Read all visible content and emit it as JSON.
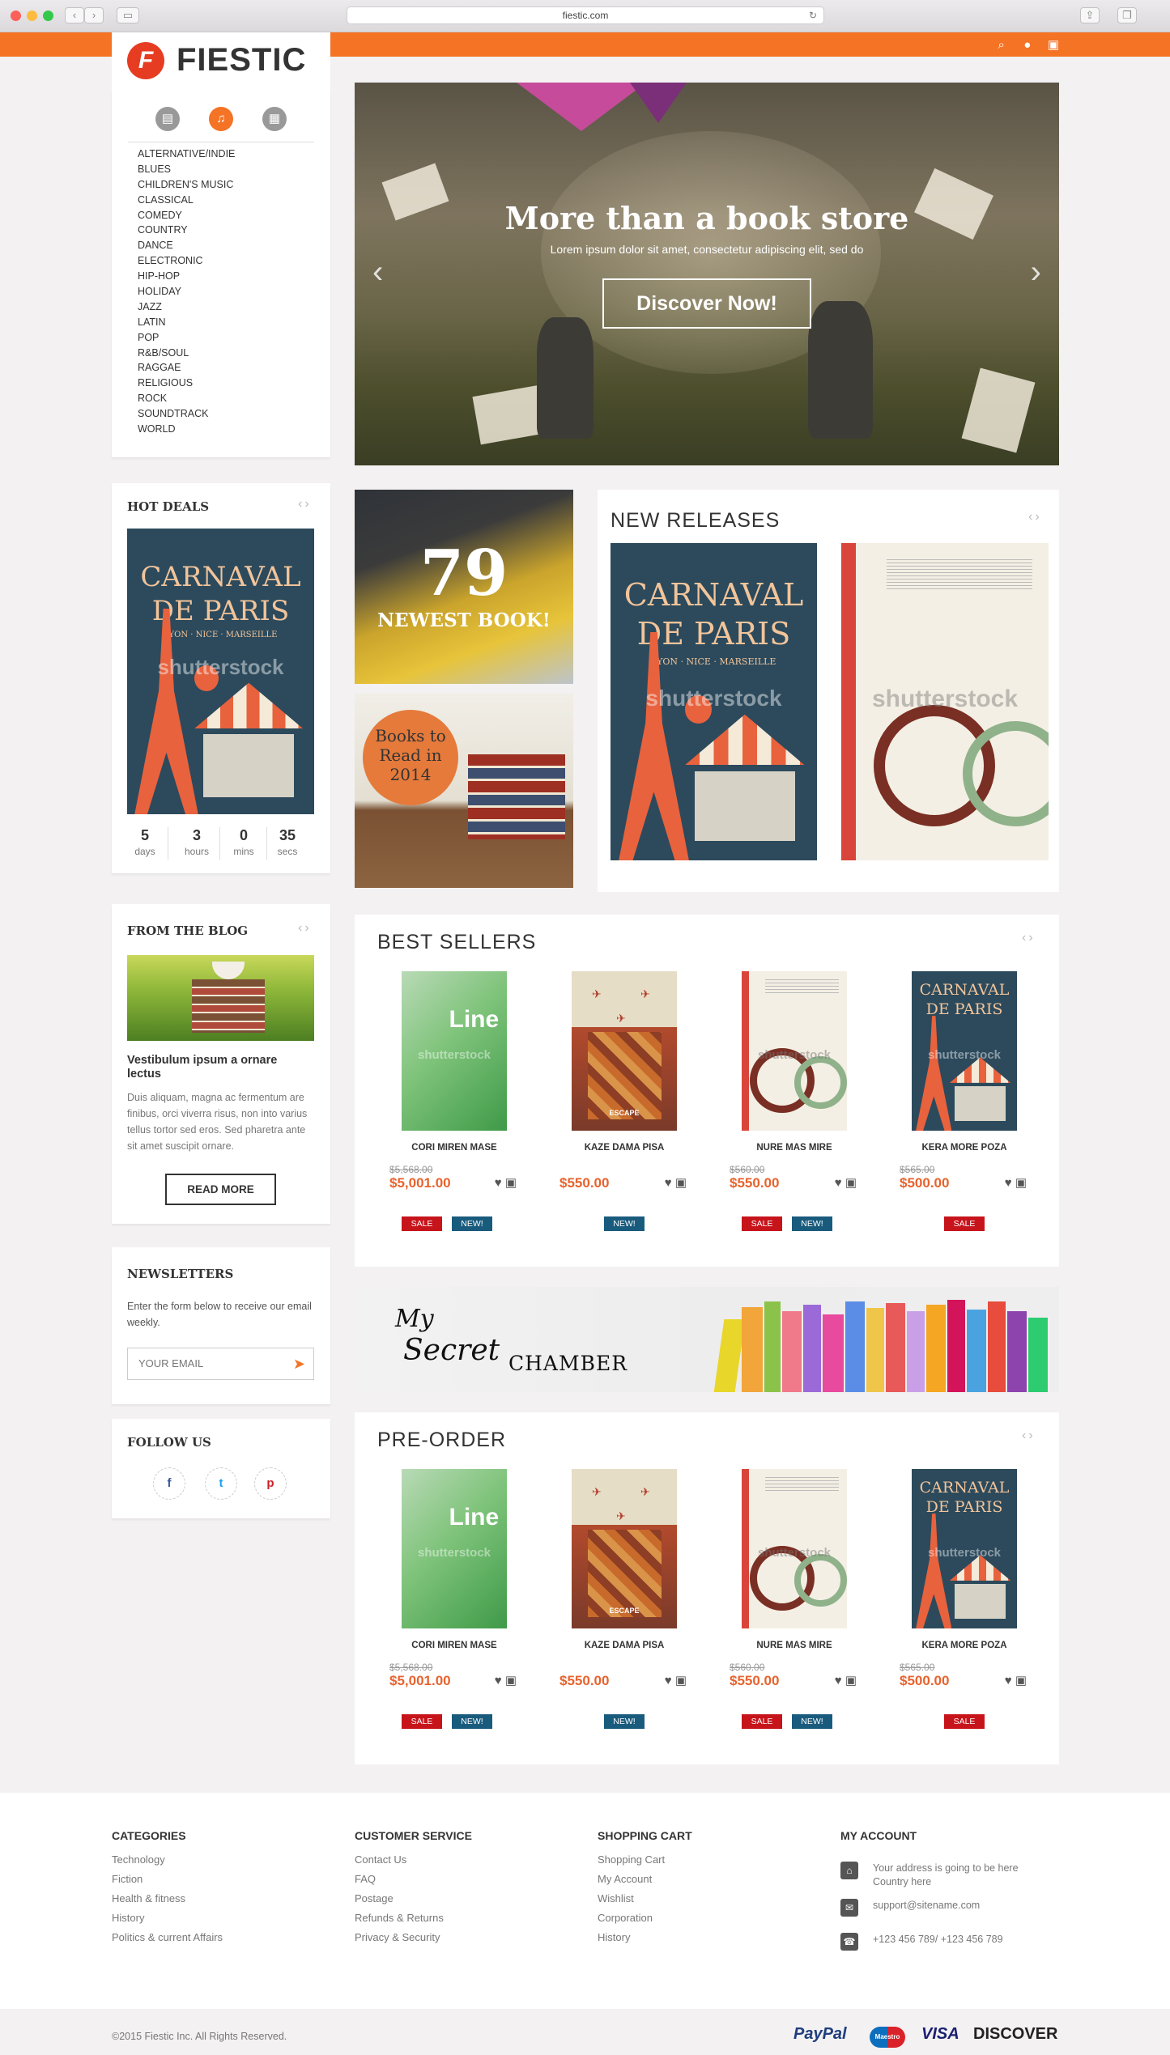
{
  "browser": {
    "url": "fiestic.com"
  },
  "brand": {
    "name": "FIESTIC",
    "letter": "F",
    "accent": "#f47325"
  },
  "header_icons": [
    "search-icon",
    "user-icon",
    "shopping-bag-icon"
  ],
  "categories": [
    "ALTERNATIVE/INDIE",
    "BLUES",
    "CHILDREN'S MUSIC",
    "CLASSICAL",
    "COMEDY",
    "COUNTRY",
    "DANCE",
    "ELECTRONIC",
    "HIP-HOP",
    "HOLIDAY",
    "JAZZ",
    "LATIN",
    "POP",
    "R&B/SOUL",
    "RAGGAE",
    "RELIGIOUS",
    "ROCK",
    "SOUNDTRACK",
    "WORLD"
  ],
  "hot_deals": {
    "title": "HOT DEALS",
    "cover": {
      "line1": "CARNAVAL",
      "line2": "DE PARIS",
      "line3": "LYON · NICE · MARSEILLE"
    },
    "countdown": [
      {
        "num": "5",
        "unit": "days"
      },
      {
        "num": "3",
        "unit": "hours"
      },
      {
        "num": "0",
        "unit": "mins"
      },
      {
        "num": "35",
        "unit": "secs"
      }
    ]
  },
  "blog": {
    "title": "FROM THE BLOG",
    "post_title": "Vestibulum ipsum a ornare lectus",
    "excerpt": "Duis aliquam, magna ac fermentum are finibus, orci viverra risus, non into varius tellus tortor sed eros. Sed pharetra ante sit amet suscipit ornare.",
    "button": "READ MORE"
  },
  "newsletter": {
    "title": "NEWSLETTERS",
    "text": "Enter the form below to receive our email weekly.",
    "placeholder": "YOUR EMAIL"
  },
  "follow": {
    "title": "FOLLOW US",
    "icons": [
      "facebook-icon",
      "twitter-icon",
      "pinterest-icon"
    ],
    "labels": [
      "f",
      "t",
      "p"
    ]
  },
  "hero": {
    "title": "More than a book store",
    "subtitle": "Lorem ipsum dolor sit amet, consectetur adipiscing elit, sed do",
    "cta": "Discover Now!"
  },
  "promo": {
    "number": "79",
    "number_text": "NEWEST BOOK!",
    "badge": "Books to Read in 2014"
  },
  "watermark": "shutterstock",
  "new_releases": {
    "title": "NEW RELEASES"
  },
  "best_sellers": {
    "title": "BEST SELLERS",
    "products": [
      {
        "name": "CORI MIREN MASE",
        "old": "$5,568.00",
        "price": "$5,001.00",
        "tags": [
          "SALE",
          "NEW!"
        ],
        "cover": "line"
      },
      {
        "name": "KAZE DAMA PISA",
        "old": "",
        "price": "$550.00",
        "tags": [
          "NEW!"
        ],
        "cover": "escape"
      },
      {
        "name": "NURE MAS MIRE",
        "old": "$560.00",
        "price": "$550.00",
        "tags": [
          "SALE",
          "NEW!"
        ],
        "cover": "bo"
      },
      {
        "name": "KERA MORE POZA",
        "old": "$565.00",
        "price": "$500.00",
        "tags": [
          "SALE"
        ],
        "cover": "carnaval"
      }
    ]
  },
  "banner": {
    "line1": "My",
    "line2": "Secret",
    "line3": "CHAMBER"
  },
  "pre_order": {
    "title": "PRE-ORDER",
    "products": [
      {
        "name": "CORI MIREN MASE",
        "old": "$5,568.00",
        "price": "$5,001.00",
        "tags": [
          "SALE",
          "NEW!"
        ],
        "cover": "line"
      },
      {
        "name": "KAZE DAMA PISA",
        "old": "",
        "price": "$550.00",
        "tags": [
          "NEW!"
        ],
        "cover": "escape"
      },
      {
        "name": "NURE MAS MIRE",
        "old": "$560.00",
        "price": "$550.00",
        "tags": [
          "SALE",
          "NEW!"
        ],
        "cover": "bo"
      },
      {
        "name": "KERA MORE POZA",
        "old": "$565.00",
        "price": "$500.00",
        "tags": [
          "SALE"
        ],
        "cover": "carnaval"
      }
    ]
  },
  "line_cover_text": "Line",
  "escape_cover_text": "ESCAPE",
  "footer": {
    "categories": {
      "title": "CATEGORIES",
      "links": [
        "Technology",
        "Fiction",
        "Health & fitness",
        "History",
        "Politics & current Affairs"
      ]
    },
    "customer_service": {
      "title": "CUSTOMER SERVICE",
      "links": [
        "Contact Us",
        "FAQ",
        "Postage",
        "Refunds & Returns",
        "Privacy & Security"
      ]
    },
    "shopping_cart": {
      "title": "SHOPPING CART",
      "links": [
        "Shopping Cart",
        "My Account",
        "Wishlist",
        "Corporation",
        "History"
      ]
    },
    "my_account": {
      "title": "MY ACCOUNT",
      "address": "Your address is going to be here Country here",
      "email": "support@sitename.com",
      "phone": "+123 456 789/ +123 456 789"
    },
    "copyright": "©2015 Fiestic Inc. All Rights Reserved.",
    "payments": [
      "PayPal",
      "Maestro",
      "VISA",
      "DISCOVER"
    ]
  }
}
